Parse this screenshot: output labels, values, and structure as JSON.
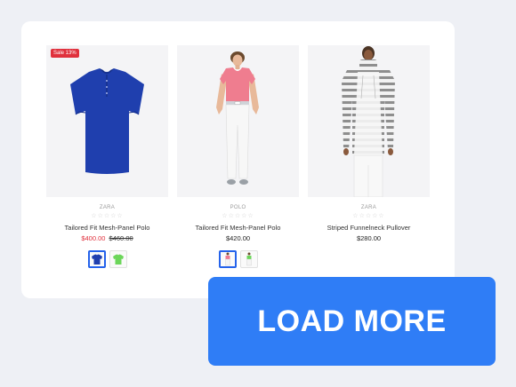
{
  "products": [
    {
      "brand": "ZARA",
      "rating_stars": "☆☆☆☆☆",
      "title": "Tailored Fit Mesh-Panel Polo",
      "sale_badge": "Sale 13%",
      "price_sale": "$400.00",
      "price_old": "$460.00",
      "swatch_colors": [
        "#1f3fae",
        "#6cd65a"
      ]
    },
    {
      "brand": "POLO",
      "rating_stars": "☆☆☆☆☆",
      "title": "Tailored Fit Mesh-Panel Polo",
      "price": "$420.00",
      "swatch_colors": [
        "#f07a91",
        "#6cd65a"
      ]
    },
    {
      "brand": "ZARA",
      "rating_stars": "☆☆☆☆☆",
      "title": "Striped Funnelneck Pullover",
      "price": "$280.00"
    }
  ],
  "load_more_label": "LOAD MORE",
  "colors": {
    "accent": "#2f7df6",
    "sale": "#e0313d"
  }
}
